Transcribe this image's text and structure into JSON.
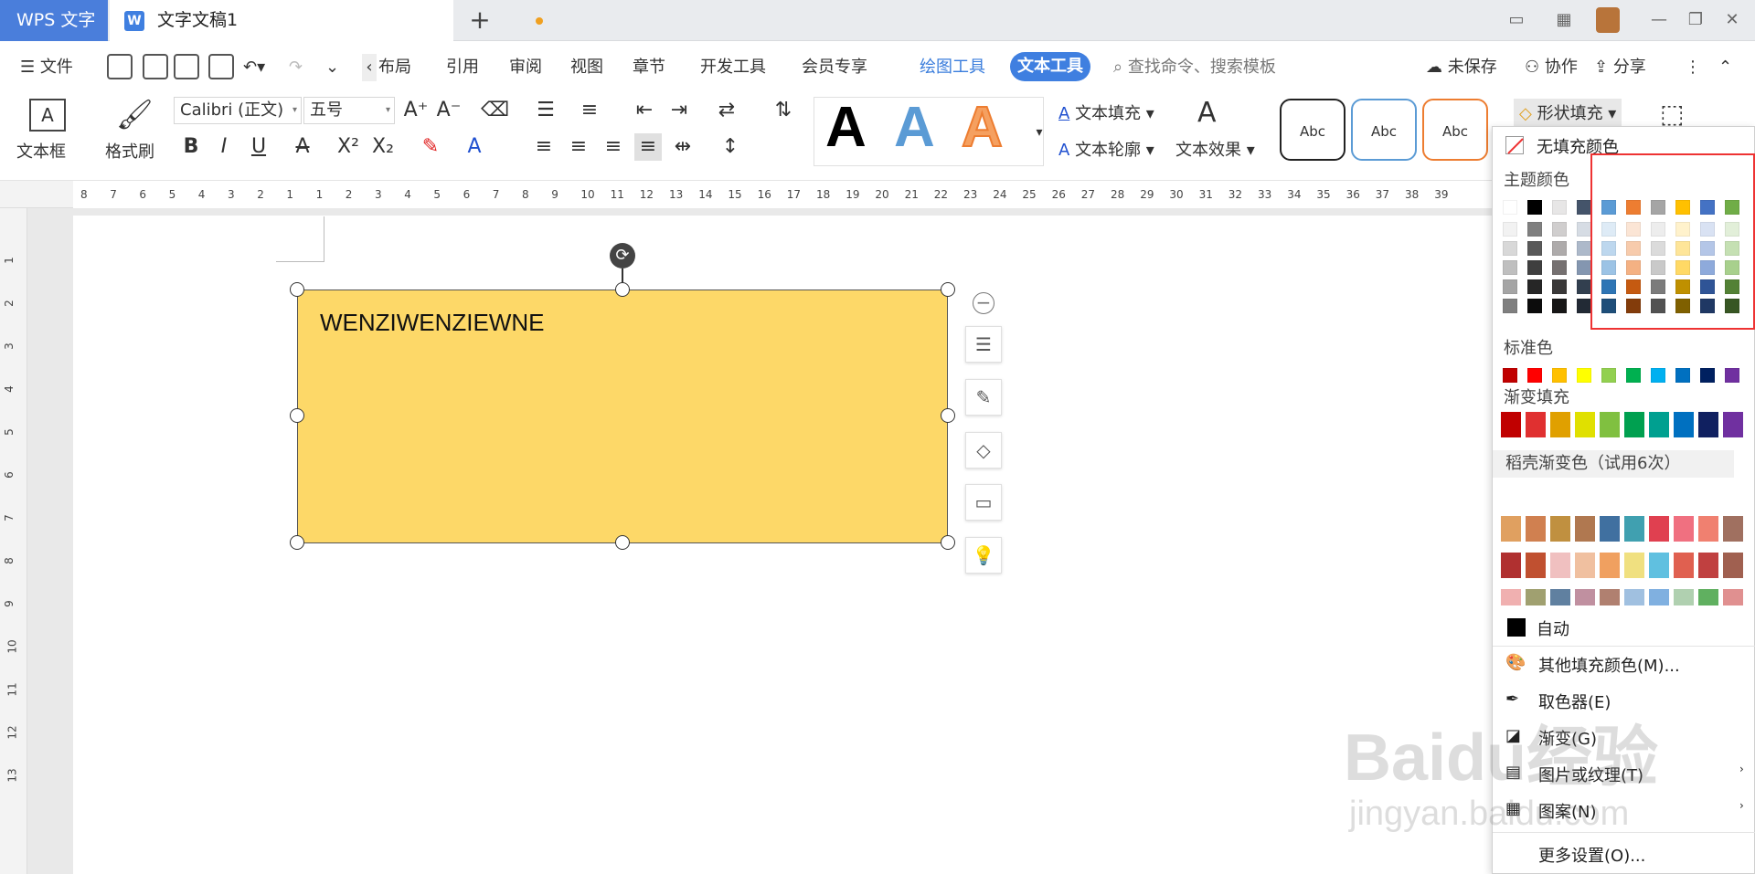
{
  "tabs": {
    "app_label": "WPS 文字",
    "doc_title": "文字文稿1",
    "add_label": "+"
  },
  "menu": {
    "file": "文件",
    "items": [
      "布局",
      "引用",
      "审阅",
      "视图",
      "章节",
      "开发工具",
      "会员专享"
    ],
    "draw_tools": "绘图工具",
    "text_tools": "文本工具",
    "search_placeholder": "查找命令、搜索模板",
    "unsaved": "未保存",
    "collab": "协作",
    "share": "分享"
  },
  "ribbon": {
    "textbox": "文本框",
    "format_painter": "格式刷",
    "font_name": "Calibri (正文)",
    "font_size": "五号",
    "text_fill": "文本填充",
    "text_outline": "文本轮廓",
    "text_effect": "文本效果",
    "shape_fill": "形状填充",
    "abc": [
      "Abc",
      "Abc",
      "Abc"
    ],
    "art_letter": "A"
  },
  "ruler": {
    "h_ticks": [
      "8",
      "7",
      "6",
      "5",
      "4",
      "3",
      "2",
      "1",
      "1",
      "2",
      "3",
      "4",
      "5",
      "6",
      "7",
      "8",
      "9",
      "10",
      "11",
      "12",
      "13",
      "14",
      "15",
      "16",
      "17",
      "18",
      "19",
      "20",
      "21",
      "22",
      "23",
      "24",
      "25",
      "26",
      "27",
      "28",
      "29",
      "30",
      "31",
      "32",
      "33",
      "34",
      "35",
      "36",
      "37",
      "38",
      "39"
    ],
    "v_ticks": [
      "1",
      "2",
      "3",
      "4",
      "5",
      "6",
      "7",
      "8",
      "9",
      "10",
      "11",
      "12",
      "13"
    ]
  },
  "document": {
    "shape_text": "WENZIWENZIEWNE",
    "shape_fill_color": "#fdd868"
  },
  "fill_menu": {
    "no_fill": "无填充颜色",
    "theme_colors": "主题颜色",
    "standard_colors": "标准色",
    "gradient_fill": "渐变填充",
    "docer_gradient": "稻壳渐变色（试用6次）",
    "auto": "自动",
    "more_colors": "其他填充颜色(M)...",
    "eyedropper": "取色器(E)",
    "gradient": "渐变(G)",
    "picture_texture": "图片或纹理(T)",
    "pattern": "图案(N)",
    "more_settings": "更多设置(O)...",
    "theme_top": [
      "#ffffff",
      "#000000",
      "#e7e6e6",
      "#44546a",
      "#5b9bd5",
      "#ed7d31",
      "#a5a5a5",
      "#ffc000",
      "#4472c4",
      "#70ad47"
    ],
    "theme_shades": [
      [
        "#f2f2f2",
        "#7f7f7f",
        "#d0cece",
        "#d6dce4",
        "#deebf6",
        "#fbe5d5",
        "#ededed",
        "#fff2cc",
        "#d9e2f3",
        "#e2efd9"
      ],
      [
        "#d8d8d8",
        "#595959",
        "#aeabab",
        "#adb9ca",
        "#bdd7ee",
        "#f7cbac",
        "#dbdbdb",
        "#fee599",
        "#b4c6e7",
        "#c5e0b3"
      ],
      [
        "#bfbfbf",
        "#3f3f3f",
        "#757070",
        "#8496b0",
        "#9cc3e5",
        "#f4b183",
        "#c9c9c9",
        "#ffd965",
        "#8eaadb",
        "#a8d08d"
      ],
      [
        "#a5a5a5",
        "#262626",
        "#3a3838",
        "#323f4f",
        "#2e75b5",
        "#c55a11",
        "#7b7b7b",
        "#bf9000",
        "#2f5496",
        "#538135"
      ],
      [
        "#7f7f7f",
        "#0c0c0c",
        "#171616",
        "#222a35",
        "#1e4e79",
        "#833c0b",
        "#525252",
        "#7f6000",
        "#1f3864",
        "#375623"
      ]
    ],
    "standard": [
      "#c00000",
      "#ff0000",
      "#ffc000",
      "#ffff00",
      "#92d050",
      "#00b050",
      "#00b0f0",
      "#0070c0",
      "#002060",
      "#7030a0"
    ],
    "gradient_row": [
      "#c00000",
      "#e03030",
      "#e0a000",
      "#e0e000",
      "#80c040",
      "#00a050",
      "#00a090",
      "#0070c0",
      "#102060",
      "#7030a0"
    ],
    "docer_rows": [
      [
        "#e0a060",
        "#d08050",
        "#c09040",
        "#b07850",
        "#4070a0",
        "#40a0b0",
        "#e04050",
        "#f07080",
        "#f08070",
        "#a07060"
      ],
      [
        "#b03030",
        "#c05030",
        "#f0c0c0",
        "#f0c0a0",
        "#f0a060",
        "#f0e080",
        "#60c0e0",
        "#e06050",
        "#c04040",
        "#a06050"
      ],
      [
        "#f0b0b0",
        "#a0a070",
        "#6080a0",
        "#c090a0",
        "#b08070",
        "#a0c0e0",
        "#80b0e0",
        "#b0d0b0",
        "#60b060",
        "#e09090"
      ]
    ]
  }
}
